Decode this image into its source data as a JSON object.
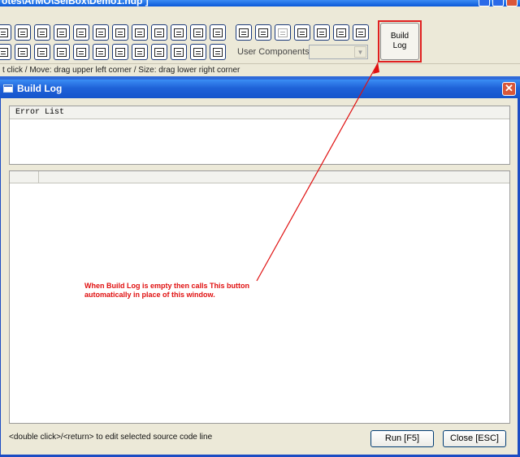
{
  "ide": {
    "title": "otes\\ArMO\\SelBox\\Demo1.hdp ]"
  },
  "toolbar": {
    "user_components_label": "User Components:",
    "user_components_value": "",
    "build_log_line1": "Build",
    "build_log_line2": "Log"
  },
  "status": {
    "text": "t click / Move: drag upper left corner / Size: drag lower right corner"
  },
  "dialog": {
    "title": "Build Log",
    "close_glyph": "✕",
    "error_list_header": "Error List",
    "hint": "<double click>/<return> to edit selected source code line",
    "run_label": "Run [F5]",
    "close_label": "Close [ESC]"
  },
  "annotation": {
    "line1": "When Build Log is empty then calls This button",
    "line2": "automatically in place of this window.",
    "color": "#e01010"
  },
  "colors": {
    "accent": "#1f62d8",
    "highlight": "#e02020"
  },
  "icons": [
    "checkbox-icon",
    "listbox-icon",
    "table-icon",
    "step-icon",
    "grid-icon",
    "label-icon",
    "frame-icon",
    "image-icon",
    "tree-icon",
    "calendar-icon",
    "ab-label-icon",
    "panel-icon",
    "timer-icon",
    "radio-icon",
    "folder-icon",
    "edit-icon",
    "text-icon",
    "spreadsheet-icon",
    "list-icon",
    "scroll-icon",
    "picture-icon",
    "rectangle-icon",
    "report-icon",
    "component-1-icon",
    "component-2-icon",
    "component-3-icon",
    "component-4-icon",
    "component-5-icon",
    "component-6-icon",
    "component-7-icon"
  ]
}
